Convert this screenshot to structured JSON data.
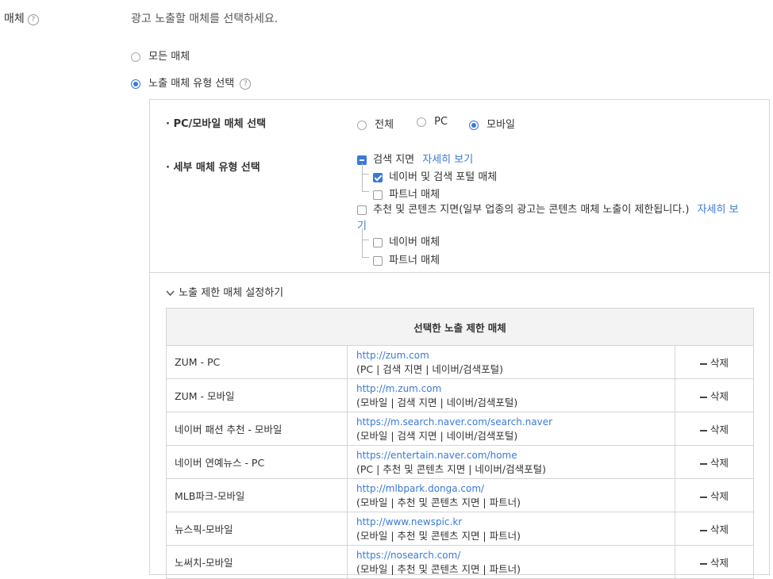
{
  "label": {
    "title": "매체",
    "help": "?"
  },
  "desc": "광고 노출할 매체를 선택하세요.",
  "options": {
    "all": "모든 매체",
    "type": "노출 매체 유형 선택"
  },
  "panel": {
    "pcm": {
      "label": "· PC/모바일 매체 선택",
      "opts": [
        "전체",
        "PC",
        "모바일"
      ]
    },
    "detail": {
      "label": "· 세부 매체 유형 선택",
      "search": {
        "label": "검색 지면",
        "link": "자세히 보기",
        "naver": "네이버 및 검색 포털 매체",
        "partner": "파트너 매체"
      },
      "content": {
        "label": "추천 및 콘텐츠 지면(일부 업종의 광고는 콘텐츠 매체 노출이 제한됩니다.)",
        "link1": "자세히 보",
        "link2": "기",
        "naver": "네이버 매체",
        "partner": "파트너 매체"
      }
    },
    "restrict": {
      "toggle": "노출 제한 매체 설정하기",
      "header": "선택한 노출 제한 매체",
      "delete_label": "삭제",
      "rows": [
        {
          "name": "ZUM - PC",
          "url": "http://zum.com",
          "info": "(PC | 검색 지면 | 네이버/검색포털)"
        },
        {
          "name": "ZUM - 모바일",
          "url": "http://m.zum.com",
          "info": "(모바일 | 검색 지면 | 네이버/검색포털)"
        },
        {
          "name": "네이버 패션 추천 - 모바일",
          "url": "https://m.search.naver.com/search.naver",
          "info": "(모바일 | 검색 지면 | 네이버/검색포털)"
        },
        {
          "name": "네이버 연예뉴스 - PC",
          "url": "https://entertain.naver.com/home",
          "info": "(PC | 추천 및 콘텐츠 지면 | 네이버/검색포털)"
        },
        {
          "name": "MLB파크-모바일",
          "url": "http://mlbpark.donga.com/",
          "info": "(모바일 | 추천 및 콘텐츠 지면 | 파트너)"
        },
        {
          "name": "뉴스픽-모바일",
          "url": "http://www.newspic.kr",
          "info": "(모바일 | 추천 및 콘텐츠 지면 | 파트너)"
        },
        {
          "name": "노써치-모바일",
          "url": "https://nosearch.com/",
          "info": "(모바일 | 추천 및 콘텐츠 지면 | 파트너)"
        }
      ]
    }
  }
}
